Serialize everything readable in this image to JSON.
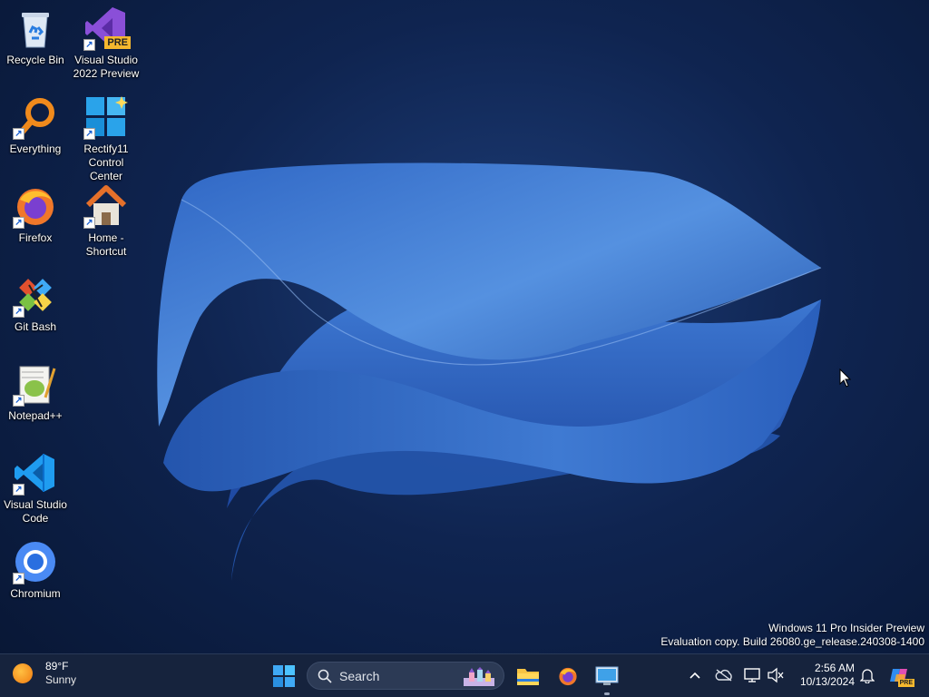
{
  "desktop": {
    "icons": [
      {
        "label": "Recycle Bin",
        "icon": "recycle-bin-icon"
      },
      {
        "label": "Visual Studio 2022 Preview",
        "icon": "visual-studio-icon",
        "badge": "PRE"
      },
      {
        "label": "Everything",
        "icon": "everything-search-icon"
      },
      {
        "label": "Rectify11 Control Center",
        "icon": "rectify11-icon"
      },
      {
        "label": "Firefox",
        "icon": "firefox-icon"
      },
      {
        "label": "Home - Shortcut",
        "icon": "home-icon"
      },
      {
        "label": "Git Bash",
        "icon": "git-bash-icon"
      },
      {
        "label": "Notepad++",
        "icon": "notepadpp-icon"
      },
      {
        "label": "Visual Studio Code",
        "icon": "vscode-icon"
      },
      {
        "label": "Chromium",
        "icon": "chromium-icon"
      }
    ],
    "shortcut_arrow": "↗",
    "watermark": {
      "line1": "Windows 11 Pro Insider Preview",
      "line2": "Evaluation copy. Build 26080.ge_release.240308-1400"
    }
  },
  "taskbar": {
    "weather": {
      "temp": "89°F",
      "condition": "Sunny"
    },
    "search": {
      "placeholder": "Search"
    },
    "apps": [
      "start-icon",
      "file-explorer-icon",
      "firefox-icon",
      "rectify11-app-icon"
    ],
    "tray": [
      "chevron-up-icon",
      "onedrive-icon",
      "network-icon",
      "volume-muted-icon",
      "notification-bell-icon",
      "copilot-icon"
    ],
    "clock": {
      "time": "2:56 AM",
      "date": "10/13/2024"
    },
    "copilot_badge": "PRE"
  },
  "colors": {
    "taskbar_bg": "#16233d",
    "wallpaper_bloom": "#3a7bd5",
    "accent": "#0078d4"
  }
}
